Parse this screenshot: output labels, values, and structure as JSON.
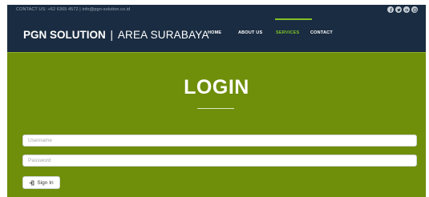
{
  "topbar": {
    "contact": "CONTACT US: +62 6365 4572 | info@pgn-solution.co.id",
    "social": [
      "facebook-icon",
      "twitter-icon",
      "google-plus-icon",
      "instagram-icon"
    ]
  },
  "brand": {
    "name": "PGN SOLUTION",
    "separator": "|",
    "area": "AREA SURABAYA"
  },
  "nav": {
    "items": [
      {
        "label": "HOME",
        "active": false
      },
      {
        "label": "ABOUT US",
        "active": false
      },
      {
        "label": "SERVICES",
        "active": true
      },
      {
        "label": "CONTACT",
        "active": false
      }
    ]
  },
  "login": {
    "title": "LOGIN",
    "username_placeholder": "Username",
    "password_placeholder": "Password",
    "signin_label": "Sign In"
  },
  "colors": {
    "topbar_bg": "#1a2c41",
    "content_bg": "#6f8e0a",
    "accent": "#7fc12a"
  }
}
